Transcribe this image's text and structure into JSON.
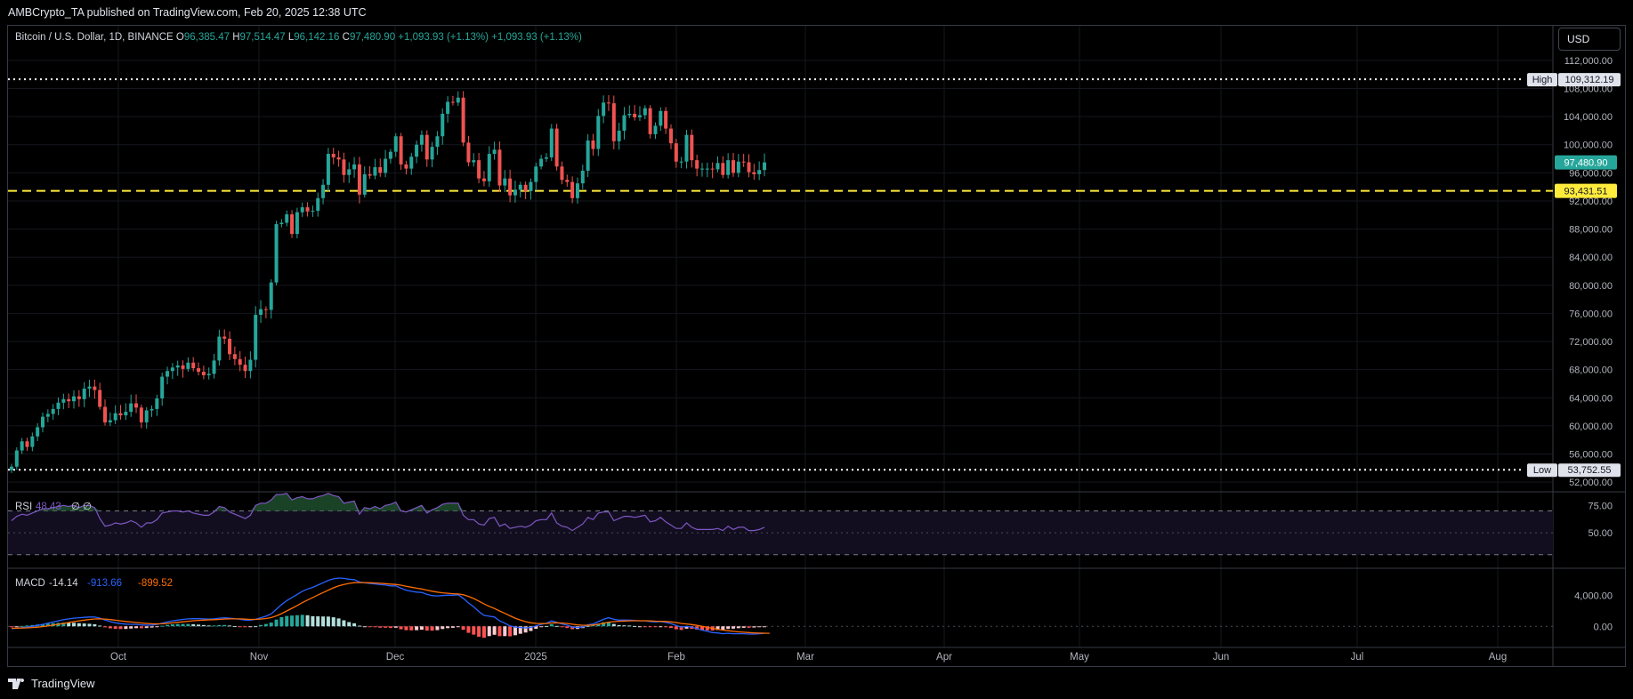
{
  "header": {
    "published_text": "AMBCrypto_TA published on TradingView.com, Feb 20, 2025 12:38 UTC",
    "symbol": "Bitcoin / U.S. Dollar, 1D, BINANCE",
    "o_label": "O",
    "o_value": "96,385.47",
    "h_label": "H",
    "h_value": "97,514.47",
    "l_label": "L",
    "l_value": "96,142.16",
    "c_label": "C",
    "c_value": "97,480.90",
    "change1": "+1,093.93 (+1.13%)",
    "change2": "+1,093.93 (+1.13%)"
  },
  "currency_button": "USD",
  "footer": {
    "logo_text": "TradingView"
  },
  "colors": {
    "up": "#26a69a",
    "down": "#ef5350",
    "rsi": "#7e57c2",
    "macd": "#2962ff",
    "signal": "#ff6d00",
    "support": "#ffeb3b"
  },
  "chart_data": [
    {
      "type": "candlestick",
      "interval": "1D",
      "ylim": [
        51000,
        113000
      ],
      "ticks": [
        "52,000.00",
        "56,000.00",
        "60,000.00",
        "64,000.00",
        "68,000.00",
        "72,000.00",
        "76,000.00",
        "80,000.00",
        "84,000.00",
        "88,000.00",
        "92,000.00",
        "96,000.00",
        "100,000.00",
        "104,000.00",
        "108,000.00",
        "112,000.00"
      ],
      "xticks": [
        "Oct",
        "Nov",
        "Dec",
        "2025",
        "Feb",
        "Mar",
        "Apr",
        "May",
        "Jun",
        "Jul",
        "Aug"
      ],
      "high": {
        "label": "High",
        "value": "109,312.19"
      },
      "low": {
        "label": "Low",
        "value": "53,752.55"
      },
      "last_price": "97,480.90",
      "support": {
        "value": "93,431.51"
      },
      "close_series": [
        54200,
        56500,
        57800,
        57000,
        58500,
        59800,
        61300,
        61700,
        62400,
        63300,
        63800,
        63500,
        64200,
        63800,
        65300,
        65600,
        65100,
        62700,
        60500,
        60800,
        61800,
        61500,
        62000,
        63200,
        62600,
        60500,
        62200,
        62400,
        63900,
        67000,
        67800,
        68300,
        68600,
        68100,
        69000,
        68200,
        67700,
        67200,
        67400,
        69300,
        72700,
        72400,
        70200,
        69500,
        68700,
        67800,
        69400,
        75800,
        76600,
        76500,
        80400,
        88700,
        88900,
        90100,
        87300,
        90400,
        91100,
        90500,
        90600,
        92400,
        94300,
        98700,
        98200,
        97900,
        95700,
        96500,
        97200,
        92900,
        95800,
        95600,
        96800,
        96000,
        98000,
        99000,
        101200,
        97200,
        96600,
        98300,
        100000,
        101400,
        97900,
        99700,
        101200,
        104400,
        106100,
        106000,
        106700,
        100300,
        97500,
        97800,
        95200,
        94800,
        98700,
        99300,
        94200,
        95200,
        92800,
        93600,
        94300,
        93400,
        94700,
        96900,
        98000,
        98200,
        102300,
        96900,
        95000,
        94700,
        92400,
        94500,
        96300,
        100600,
        99400,
        104100,
        106000,
        105900,
        100500,
        102000,
        104200,
        104400,
        103900,
        104200,
        105200,
        101500,
        102700,
        104800,
        102300,
        100200,
        97600,
        97600,
        101400,
        97800,
        96600,
        96600,
        96600,
        96500,
        97400,
        95700,
        97800,
        96000,
        97600,
        97500,
        96100,
        95800,
        96400,
        97480
      ]
    },
    {
      "type": "line",
      "name": "RSI",
      "value": "48.43",
      "extra": [
        "∅",
        "∅"
      ],
      "ylim": [
        20,
        85
      ],
      "levels": [
        "75.00",
        "50.00"
      ],
      "values": [
        61,
        65,
        67,
        66,
        68,
        70,
        72,
        72,
        73,
        74,
        75,
        74,
        75,
        73,
        75,
        75,
        73,
        63,
        56,
        57,
        59,
        58,
        59,
        61,
        59,
        55,
        59,
        59,
        62,
        68,
        69,
        70,
        70,
        69,
        70,
        68,
        67,
        66,
        66,
        69,
        74,
        73,
        69,
        67,
        65,
        63,
        66,
        75,
        77,
        77,
        80,
        85,
        85,
        86,
        80,
        82,
        83,
        81,
        81,
        83,
        84,
        86,
        84,
        83,
        77,
        78,
        79,
        67,
        73,
        72,
        74,
        72,
        75,
        76,
        78,
        70,
        69,
        71,
        73,
        75,
        68,
        71,
        73,
        76,
        77,
        77,
        77,
        66,
        62,
        62,
        58,
        57,
        63,
        64,
        56,
        58,
        54,
        55,
        56,
        55,
        57,
        61,
        62,
        62,
        68,
        59,
        56,
        55,
        52,
        55,
        58,
        64,
        62,
        68,
        69,
        69,
        61,
        63,
        65,
        65,
        64,
        65,
        66,
        60,
        61,
        64,
        60,
        57,
        54,
        54,
        59,
        55,
        53,
        53,
        53,
        53,
        54,
        52,
        56,
        53,
        55,
        55,
        52,
        52,
        53,
        55
      ]
    },
    {
      "type": "line",
      "name": "MACD",
      "values": [
        "-14.14",
        "-913.66",
        "-899.52"
      ],
      "ticks": [
        "4,000.00",
        "0.00"
      ],
      "ylim": [
        -1800,
        7000
      ],
      "macd": [
        -300,
        -250,
        -180,
        -100,
        0,
        120,
        250,
        400,
        550,
        700,
        850,
        950,
        1050,
        1100,
        1150,
        1200,
        1200,
        1050,
        800,
        600,
        450,
        350,
        280,
        260,
        250,
        180,
        150,
        170,
        250,
        400,
        550,
        700,
        800,
        880,
        950,
        980,
        980,
        960,
        930,
        950,
        1050,
        1100,
        1050,
        980,
        900,
        800,
        780,
        900,
        1100,
        1300,
        1600,
        2200,
        2800,
        3300,
        3700,
        4100,
        4500,
        4800,
        5000,
        5300,
        5600,
        5900,
        6100,
        6200,
        6150,
        6050,
        6000,
        5700,
        5600,
        5500,
        5450,
        5350,
        5300,
        5200,
        5200,
        4900,
        4650,
        4500,
        4400,
        4350,
        4100,
        3950,
        3900,
        3950,
        4000,
        4000,
        4050,
        3600,
        3000,
        2500,
        1900,
        1400,
        1300,
        1200,
        700,
        400,
        50,
        -100,
        -150,
        -200,
        -150,
        50,
        250,
        400,
        700,
        500,
        300,
        150,
        -100,
        -150,
        -100,
        200,
        300,
        600,
        900,
        1100,
        900,
        800,
        800,
        800,
        750,
        700,
        700,
        600,
        550,
        600,
        500,
        350,
        100,
        -100,
        0,
        -100,
        -300,
        -500,
        -650,
        -800,
        -850,
        -950,
        -900,
        -950,
        -950,
        -950,
        -1000,
        -1000,
        -950,
        -914
      ],
      "signal": [
        -250,
        -240,
        -225,
        -200,
        -160,
        -105,
        -35,
        50,
        150,
        260,
        375,
        490,
        600,
        700,
        790,
        875,
        940,
        960,
        930,
        860,
        780,
        700,
        620,
        550,
        490,
        430,
        370,
        330,
        310,
        330,
        370,
        440,
        510,
        580,
        650,
        710,
        760,
        800,
        830,
        850,
        890,
        930,
        950,
        960,
        950,
        920,
        890,
        890,
        930,
        1000,
        1120,
        1340,
        1630,
        1970,
        2320,
        2670,
        3030,
        3380,
        3700,
        4020,
        4340,
        4650,
        4940,
        5190,
        5380,
        5510,
        5610,
        5620,
        5620,
        5600,
        5570,
        5530,
        5480,
        5420,
        5380,
        5280,
        5150,
        5020,
        4900,
        4790,
        4650,
        4510,
        4390,
        4300,
        4240,
        4190,
        4160,
        4050,
        3840,
        3570,
        3240,
        2870,
        2560,
        2290,
        1970,
        1660,
        1340,
        1050,
        810,
        600,
        450,
        370,
        350,
        360,
        430,
        450,
        420,
        370,
        270,
        190,
        130,
        140,
        170,
        260,
        380,
        530,
        600,
        650,
        680,
        700,
        710,
        710,
        710,
        690,
        660,
        650,
        620,
        570,
        480,
        370,
        300,
        220,
        120,
        0,
        -130,
        -260,
        -380,
        -490,
        -570,
        -650,
        -710,
        -760,
        -810,
        -850,
        -870,
        -880,
        -900
      ]
    }
  ]
}
